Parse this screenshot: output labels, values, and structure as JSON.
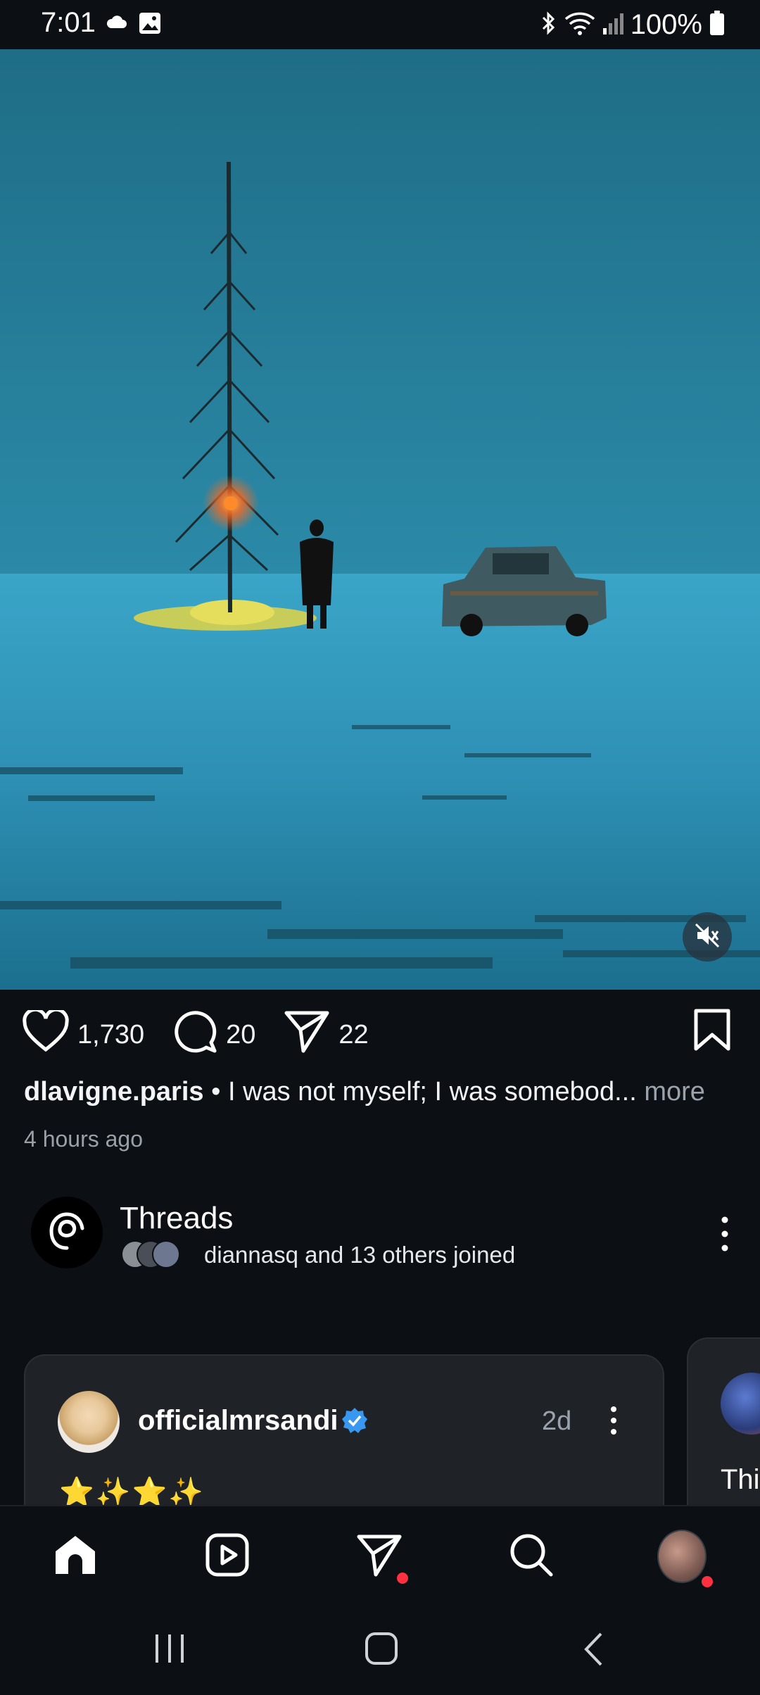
{
  "status_bar": {
    "time": "7:01",
    "battery_percent": "100%",
    "icons": [
      "cloud-icon",
      "image-icon",
      "bluetooth-icon",
      "wifi-icon",
      "signal-icon",
      "battery-icon"
    ]
  },
  "post": {
    "actions": {
      "likes": "1,730",
      "comments": "20",
      "shares": "22"
    },
    "caption": {
      "username": "dlavigne.paris",
      "separator": " • ",
      "text": "I was not myself; I was somebod...",
      "more_label": "more"
    },
    "time_ago": "4 hours ago"
  },
  "threads": {
    "title": "Threads",
    "subtitle": "diannasq and 13 others joined"
  },
  "cards": [
    {
      "username": "officialmrsandi",
      "time": "2d",
      "text": "⭐✨⭐✨"
    },
    {
      "text": "Thi"
    }
  ],
  "colors": {
    "background": "#0c0f14",
    "card": "#1f2227",
    "verified": "#3897f0",
    "notification_dot": "#ff3040",
    "muted_text": "#9aa3ad"
  }
}
